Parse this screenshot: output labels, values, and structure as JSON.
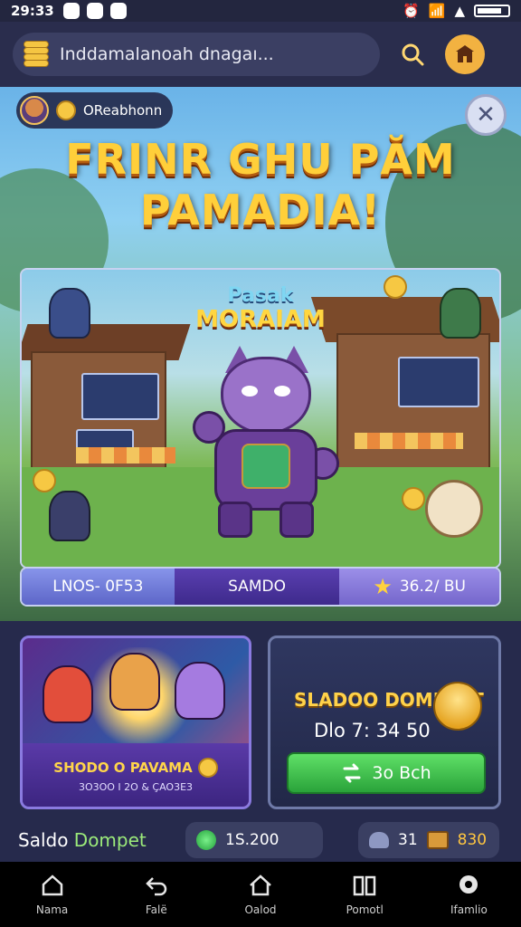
{
  "status_bar": {
    "time": "29:33"
  },
  "top_bar": {
    "search_text": "Inddamalanoah dnagaı...",
    "icons": {
      "left": "coins-stack-icon",
      "search": "search-icon",
      "shop": "shop-icon"
    }
  },
  "hero": {
    "player_name": "OReabhonn",
    "title_line1": "FRINR GHU PĂM",
    "title_line2": "PAMADIA!",
    "art_title_line1": "Pasak",
    "art_title_line2": "MORAIAM"
  },
  "stats": [
    {
      "label": "LNOS- 0F53"
    },
    {
      "label": "SAMDO"
    },
    {
      "label": "36.2/ BU",
      "icon": "star-icon"
    }
  ],
  "promo_card": {
    "title": "SHODO O PAVAMA",
    "subtitle": "3O3OO I 2O & ÇAO3E3"
  },
  "wallet_card": {
    "title": "SLADOO DOMPETT",
    "amount": "Dlo 7: 34 50",
    "button_label": "3o Bch"
  },
  "balance_row": {
    "label_part1": "Saldo ",
    "label_part2": "Dompet",
    "gem_value": "1S.200",
    "people_value": "31",
    "chest_value": "830"
  },
  "bottom_nav": [
    {
      "label": "Nama",
      "icon": "home-icon"
    },
    {
      "label": "Falë",
      "icon": "undo-icon"
    },
    {
      "label": "Oalod",
      "icon": "house-icon"
    },
    {
      "label": "Pomotl",
      "icon": "book-icon"
    },
    {
      "label": "Ifamlio",
      "icon": "chat-icon"
    }
  ],
  "colors": {
    "accent_gold": "#ffcf3a",
    "panel_bg": "#262a4c",
    "button_green": "#2aa33a"
  }
}
